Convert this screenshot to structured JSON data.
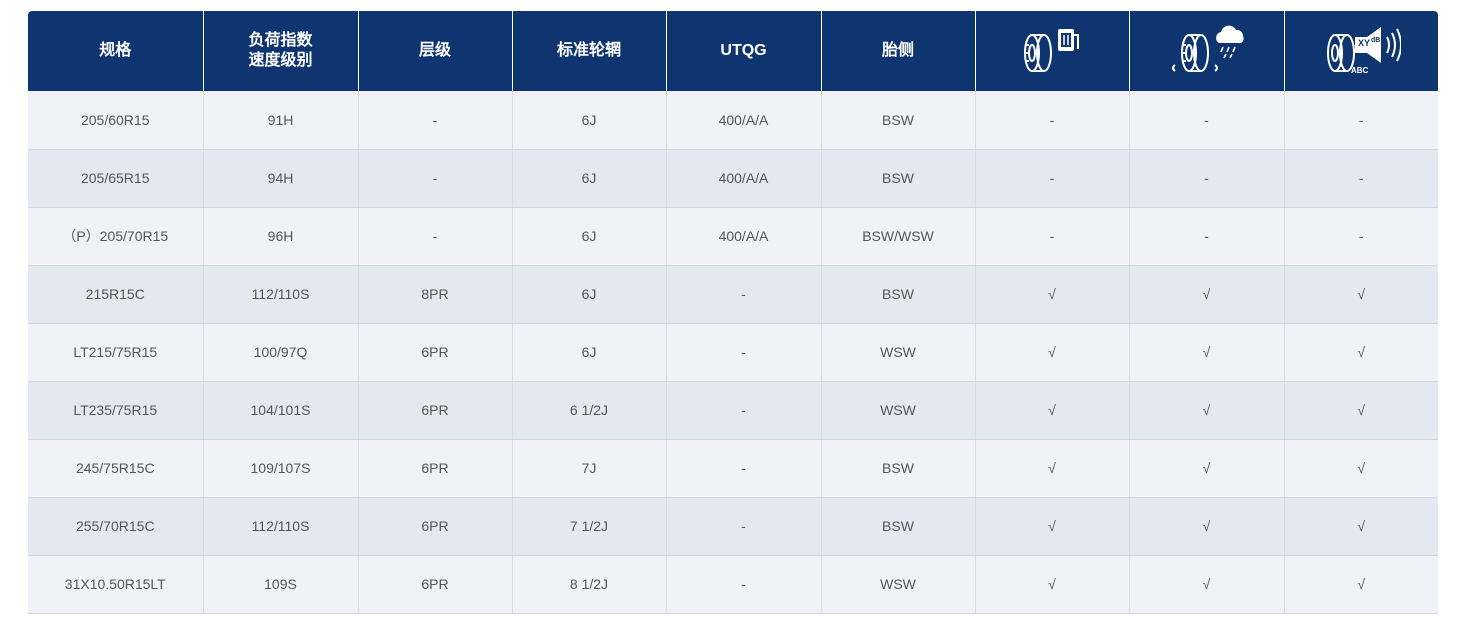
{
  "header": {
    "spec": "规格",
    "load_speed_line1": "负荷指数",
    "load_speed_line2": "速度级别",
    "ply": "层级",
    "rim": "标准轮辋",
    "utqg": "UTQG",
    "sidewall": "胎侧",
    "icon_fuel": "tire-fuel-efficiency-icon",
    "icon_wet": "tire-wet-grip-icon",
    "icon_noise": "tire-noise-icon",
    "noise_xy": "XY",
    "noise_db": "dB",
    "noise_abc": "ABC"
  },
  "rows": [
    {
      "spec": "205/60R15",
      "load": "91H",
      "ply": "-",
      "rim": "6J",
      "utqg": "400/A/A",
      "side": "BSW",
      "fuel": "-",
      "wet": "-",
      "noise": "-"
    },
    {
      "spec": "205/65R15",
      "load": "94H",
      "ply": "-",
      "rim": "6J",
      "utqg": "400/A/A",
      "side": "BSW",
      "fuel": "-",
      "wet": "-",
      "noise": "-"
    },
    {
      "spec": "（P）205/70R15",
      "load": "96H",
      "ply": "-",
      "rim": "6J",
      "utqg": "400/A/A",
      "side": "BSW/WSW",
      "fuel": "-",
      "wet": "-",
      "noise": "-"
    },
    {
      "spec": "215R15C",
      "load": "112/110S",
      "ply": "8PR",
      "rim": "6J",
      "utqg": "-",
      "side": "BSW",
      "fuel": "√",
      "wet": "√",
      "noise": "√"
    },
    {
      "spec": "LT215/75R15",
      "load": "100/97Q",
      "ply": "6PR",
      "rim": "6J",
      "utqg": "-",
      "side": "WSW",
      "fuel": "√",
      "wet": "√",
      "noise": "√"
    },
    {
      "spec": "LT235/75R15",
      "load": "104/101S",
      "ply": "6PR",
      "rim": "6 1/2J",
      "utqg": "-",
      "side": "WSW",
      "fuel": "√",
      "wet": "√",
      "noise": "√"
    },
    {
      "spec": "245/75R15C",
      "load": "109/107S",
      "ply": "6PR",
      "rim": "7J",
      "utqg": "-",
      "side": "BSW",
      "fuel": "√",
      "wet": "√",
      "noise": "√"
    },
    {
      "spec": "255/70R15C",
      "load": "112/110S",
      "ply": "6PR",
      "rim": "7 1/2J",
      "utqg": "-",
      "side": "BSW",
      "fuel": "√",
      "wet": "√",
      "noise": "√"
    },
    {
      "spec": "31X10.50R15LT",
      "load": "109S",
      "ply": "6PR",
      "rim": "8 1/2J",
      "utqg": "-",
      "side": "WSW",
      "fuel": "√",
      "wet": "√",
      "noise": "√"
    }
  ],
  "colors": {
    "header_bg": "#0f3570",
    "header_text": "#ffffff",
    "row_odd": "#f0f2f7",
    "row_even": "#e4e8f0",
    "cell_text": "#555555"
  }
}
